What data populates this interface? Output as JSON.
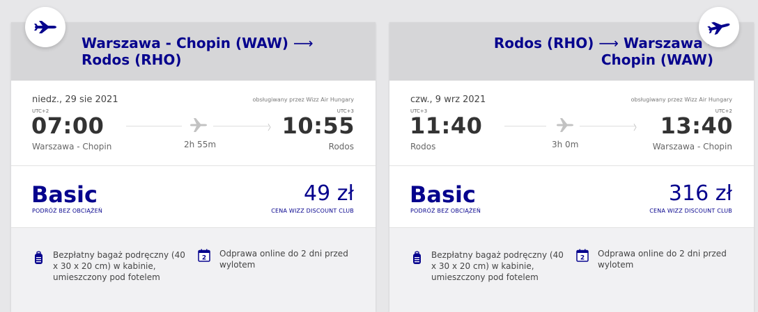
{
  "colors": {
    "brand": "#06038d",
    "background": "#e7e7e9",
    "header": "#d6d6d8",
    "benefits_bg": "#f1f1f3"
  },
  "outbound": {
    "route": {
      "origin": "Warszawa - Chopin (WAW)",
      "arrow": "⟶",
      "destination": "Rodos (RHO)"
    },
    "date": "niedz., 29 sie 2021",
    "operator": "obsługiwany przez Wizz Air Hungary",
    "departure": {
      "utc": "UTC+2",
      "time": "07:00",
      "city": "Warszawa - Chopin"
    },
    "arrival": {
      "utc": "UTC+3",
      "time": "10:55",
      "city": "Rodos"
    },
    "duration": "2h 55m",
    "fare": {
      "name": "Basic",
      "subtitle": "PODRÓŻ BEZ OBCIĄŻEŃ",
      "price": "49 zł",
      "price_note": "CENA WIZZ DISCOUNT CLUB"
    },
    "benefits": {
      "bag": "Bezpłatny bagaż podręczny (40 x 30 x 20 cm) w kabinie, umieszczony pod fotelem",
      "checkin_icon_text": "2",
      "checkin": "Odprawa online do 2 dni przed wylotem"
    }
  },
  "return": {
    "route": {
      "origin": "Rodos (RHO)",
      "arrow": "⟶",
      "destination": "Warszawa - Chopin (WAW)"
    },
    "date": "czw., 9 wrz 2021",
    "operator": "obsługiwany przez Wizz Air Hungary",
    "departure": {
      "utc": "UTC+3",
      "time": "11:40",
      "city": "Rodos"
    },
    "arrival": {
      "utc": "UTC+2",
      "time": "13:40",
      "city": "Warszawa - Chopin"
    },
    "duration": "3h 0m",
    "fare": {
      "name": "Basic",
      "subtitle": "PODRÓŻ BEZ OBCIĄŻEŃ",
      "price": "316 zł",
      "price_note": "CENA WIZZ DISCOUNT CLUB"
    },
    "benefits": {
      "bag": "Bezpłatny bagaż podręczny (40 x 30 x 20 cm) w kabinie, umieszczony pod fotelem",
      "checkin_icon_text": "2",
      "checkin": "Odprawa online do 2 dni przed wylotem"
    }
  },
  "icons": {
    "header": "airplane-icon",
    "duration": "airplane-icon",
    "bag": "backpack-icon",
    "checkin": "calendar-icon"
  }
}
